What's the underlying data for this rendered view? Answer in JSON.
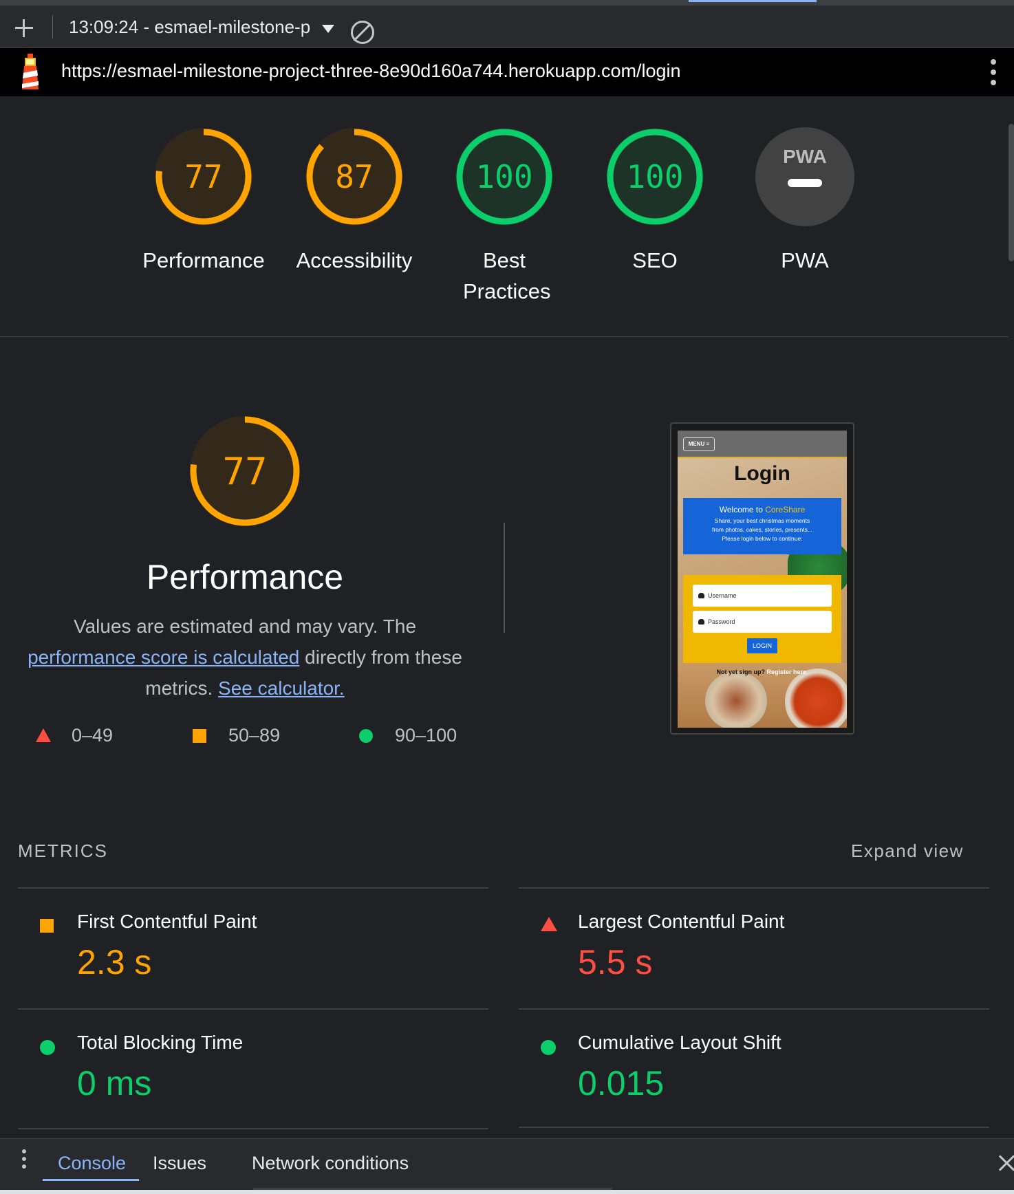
{
  "toolbar": {
    "report_label": "13:09:24 - esmael-milestone-p"
  },
  "urlbar": {
    "url": "https://esmael-milestone-project-three-8e90d160a744.herokuapp.com/login"
  },
  "gauges": [
    {
      "label": "Performance",
      "score": "77",
      "value": 77,
      "color": "#ffa400"
    },
    {
      "label": "Accessibility",
      "score": "87",
      "value": 87,
      "color": "#ffa400"
    },
    {
      "label": "Best Practices",
      "score": "100",
      "value": 100,
      "color": "#0cce6b"
    },
    {
      "label": "SEO",
      "score": "100",
      "value": 100,
      "color": "#0cce6b"
    },
    {
      "label": "PWA",
      "score": "PWA",
      "value": 0,
      "color": "#5f6368"
    }
  ],
  "performance": {
    "score": "77",
    "value": 77,
    "title": "Performance",
    "desc_prefix": "Values are estimated and may vary. The ",
    "link1": "performance score is calculated",
    "desc_middle": " directly from these metrics. ",
    "link2": "See calculator."
  },
  "legend": [
    {
      "range": "0–49",
      "color": "#ff4e42"
    },
    {
      "range": "50–89",
      "color": "#ffa400"
    },
    {
      "range": "90–100",
      "color": "#0cce6b"
    }
  ],
  "screenshot": {
    "menu": "MENU ≡",
    "login": "Login",
    "welcome": "Welcome to ",
    "brand": "CoreShare",
    "line1": "Share, your best christmas moments",
    "line2": "from photos, cakes, stories, presents...",
    "line3": "Please login below to continue:",
    "username": "Username",
    "password": "Password",
    "button": "LOGIN",
    "signup_q": "Not yet sign up? ",
    "signup_link": "Register here."
  },
  "metrics": {
    "header": "METRICS",
    "expand": "Expand view",
    "items": [
      {
        "name": "First Contentful Paint",
        "value": "2.3 s",
        "status": "average",
        "color": "#ffa400"
      },
      {
        "name": "Largest Contentful Paint",
        "value": "5.5 s",
        "status": "fail",
        "color": "#ff4e42"
      },
      {
        "name": "Total Blocking Time",
        "value": "0 ms",
        "status": "pass",
        "color": "#0cce6b"
      },
      {
        "name": "Cumulative Layout Shift",
        "value": "0.015",
        "status": "pass",
        "color": "#0cce6b"
      }
    ]
  },
  "drawer": {
    "tabs": [
      "Console",
      "Issues",
      "Network conditions"
    ]
  }
}
